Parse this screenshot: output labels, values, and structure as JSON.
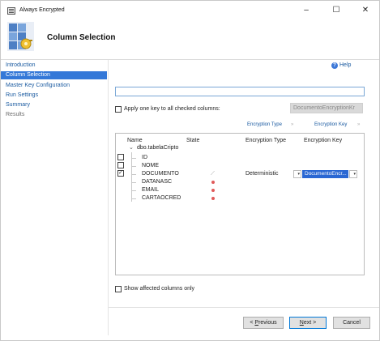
{
  "window": {
    "title": "Always Encrypted",
    "minimize_glyph": "–",
    "maximize_glyph": "☐",
    "close_glyph": "✕"
  },
  "header": {
    "title": "Column Selection",
    "icon": "wizard-page-icon"
  },
  "nav": {
    "items": [
      {
        "label": "Introduction",
        "state": "link"
      },
      {
        "label": "Column Selection",
        "state": "active"
      },
      {
        "label": "Master Key Configuration",
        "state": "link"
      },
      {
        "label": "Run Settings",
        "state": "link"
      },
      {
        "label": "Summary",
        "state": "link"
      },
      {
        "label": "Results",
        "state": "disabled"
      }
    ]
  },
  "help": {
    "label": "Help",
    "icon": "help-icon",
    "glyph": "?"
  },
  "apply_key": {
    "label": "Apply one key to all checked columns:",
    "checked": false,
    "selected_key": "DocumentoEncryptionKr"
  },
  "bulk_headers": {
    "encryption_type": "Encryption Type",
    "encryption_key": "Encryption Key",
    "arrow": "»"
  },
  "grid": {
    "columns": {
      "name": "Name",
      "state": "State",
      "encryption_type": "Encryption Type",
      "encryption_key": "Encryption Key"
    },
    "table": {
      "expander": "⌄",
      "name": "dbo.tabelaCripto"
    },
    "rows": [
      {
        "name": "ID",
        "checked": false,
        "state": "",
        "encryption_type": "",
        "encryption_key": ""
      },
      {
        "name": "NOME",
        "checked": false,
        "state": "",
        "encryption_type": "",
        "encryption_key": ""
      },
      {
        "name": "DOCUMENTO",
        "checked": true,
        "state": "pencil",
        "encryption_type": "Deterministic",
        "encryption_key": "DocumentoEncr..."
      },
      {
        "name": "DATANASC",
        "checked": null,
        "state": "dot",
        "encryption_type": "",
        "encryption_key": ""
      },
      {
        "name": "EMAIL",
        "checked": null,
        "state": "dot",
        "encryption_type": "",
        "encryption_key": ""
      },
      {
        "name": "CARTAOCRED",
        "checked": null,
        "state": "dot",
        "encryption_type": "",
        "encryption_key": ""
      }
    ],
    "pencil_glyph": "⟋",
    "dropdown_glyph": "▾"
  },
  "show_affected": {
    "label": "Show affected columns only",
    "checked": false
  },
  "buttons": {
    "previous_prefix": "< ",
    "previous_accel": "P",
    "previous_rest": "revious",
    "next_accel": "N",
    "next_rest": "ext >",
    "cancel": "Cancel"
  },
  "colors": {
    "accent": "#3478d8",
    "link": "#1a5aa0",
    "state_dot": "#e05a5a"
  }
}
